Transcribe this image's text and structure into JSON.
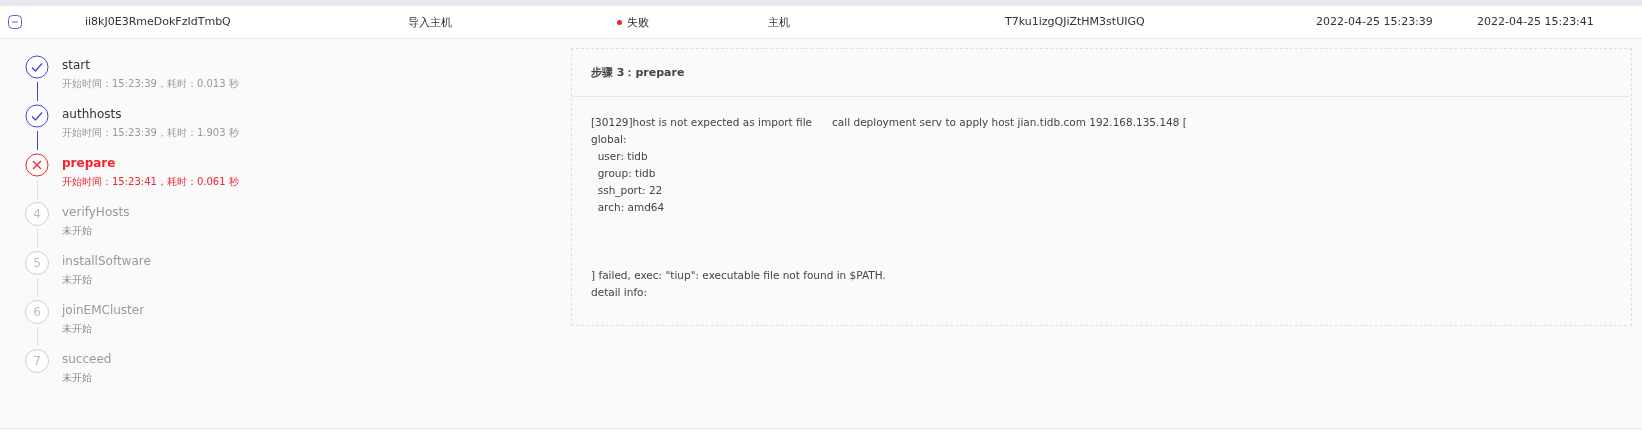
{
  "row": {
    "expanded": true,
    "id": "ii8kJ0E3RmeDokFzIdTmbQ",
    "task_type": "导入主机",
    "status": {
      "label": "失败",
      "color": "#f5222d"
    },
    "target": "主机",
    "object_id": "T7ku1izgQJiZtHM3stUIGQ",
    "start_time": "2022-04-25 15:23:39",
    "end_time": "2022-04-25 15:23:41"
  },
  "steps": [
    {
      "name": "start",
      "kind": "done",
      "detail": "开始时间：15:23:39，耗时：0.013 秒"
    },
    {
      "name": "authhosts",
      "kind": "done",
      "detail": "开始时间：15:23:39，耗时：1.903 秒"
    },
    {
      "name": "prepare",
      "kind": "error",
      "detail": "开始时间：15:23:41，耗时：0.061 秒"
    },
    {
      "name": "verifyHosts",
      "kind": "pending",
      "number": "4",
      "detail": "未开始"
    },
    {
      "name": "installSoftware",
      "kind": "pending",
      "number": "5",
      "detail": "未开始"
    },
    {
      "name": "joinEMCluster",
      "kind": "pending",
      "number": "6",
      "detail": "未开始"
    },
    {
      "name": "succeed",
      "kind": "pending",
      "number": "7",
      "detail": "未开始"
    }
  ],
  "panel": {
    "title": "步骤 3：prepare",
    "log": "[30129]host is not expected as import file      call deployment serv to apply host jian.tidb.com 192.168.135.148 [\nglobal:\n  user: tidb\n  group: tidb\n  ssh_port: 22\n  arch: amd64\n\n\n\n] failed, exec: \"tiup\": executable file not found in $PATH.\ndetail info:"
  }
}
